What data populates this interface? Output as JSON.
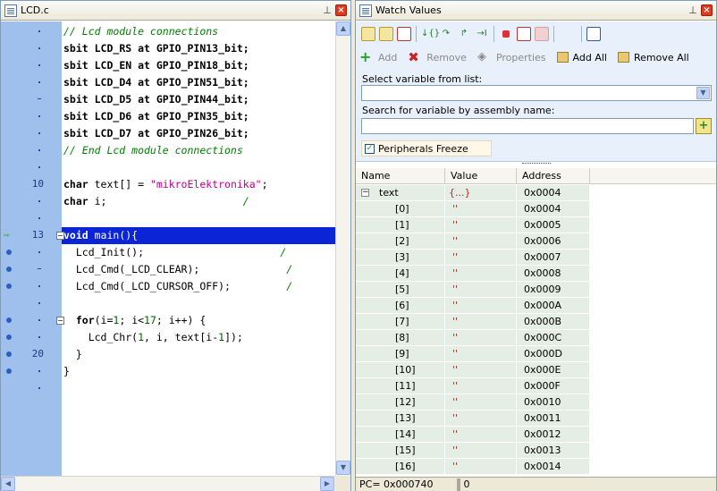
{
  "editor": {
    "title": "LCD.c",
    "gutter": [
      {
        "n": "",
        "m": "dot",
        "bp": false,
        "arrow": false
      },
      {
        "n": "",
        "m": "dot",
        "bp": false,
        "arrow": false
      },
      {
        "n": "",
        "m": "dot",
        "bp": false,
        "arrow": false
      },
      {
        "n": "",
        "m": "dot",
        "bp": false,
        "arrow": false
      },
      {
        "n": "",
        "m": "dash",
        "bp": false,
        "arrow": false
      },
      {
        "n": "",
        "m": "dot",
        "bp": false,
        "arrow": false
      },
      {
        "n": "",
        "m": "dot",
        "bp": false,
        "arrow": false
      },
      {
        "n": "",
        "m": "dot",
        "bp": false,
        "arrow": false
      },
      {
        "n": "",
        "m": "dot",
        "bp": false,
        "arrow": false
      },
      {
        "n": "10",
        "m": "",
        "bp": false,
        "arrow": false
      },
      {
        "n": "",
        "m": "dot",
        "bp": false,
        "arrow": false
      },
      {
        "n": "",
        "m": "dot",
        "bp": false,
        "arrow": false
      },
      {
        "n": "13",
        "m": "",
        "bp": false,
        "arrow": true
      },
      {
        "n": "",
        "m": "dot",
        "bp": true,
        "arrow": false
      },
      {
        "n": "",
        "m": "dash",
        "bp": true,
        "arrow": false
      },
      {
        "n": "",
        "m": "dot",
        "bp": true,
        "arrow": false
      },
      {
        "n": "",
        "m": "dot",
        "bp": false,
        "arrow": false
      },
      {
        "n": "",
        "m": "dot",
        "bp": true,
        "arrow": false
      },
      {
        "n": "",
        "m": "dot",
        "bp": true,
        "arrow": false
      },
      {
        "n": "20",
        "m": "",
        "bp": true,
        "arrow": false
      },
      {
        "n": "",
        "m": "dot",
        "bp": true,
        "arrow": false
      },
      {
        "n": "",
        "m": "dot",
        "bp": false,
        "arrow": false
      }
    ],
    "lines": [
      [
        {
          "t": "// Lcd module connections",
          "c": "cm"
        }
      ],
      [
        {
          "t": "sbit ",
          "c": "kw"
        },
        {
          "t": "LCD_RS ",
          "c": "kw"
        },
        {
          "t": "at ",
          "c": "kw"
        },
        {
          "t": "GPIO_PIN13_bit;",
          "c": "kw"
        }
      ],
      [
        {
          "t": "sbit ",
          "c": "kw"
        },
        {
          "t": "LCD_EN ",
          "c": "kw"
        },
        {
          "t": "at ",
          "c": "kw"
        },
        {
          "t": "GPIO_PIN18_bit;",
          "c": "kw"
        }
      ],
      [
        {
          "t": "sbit ",
          "c": "kw"
        },
        {
          "t": "LCD_D4 ",
          "c": "kw"
        },
        {
          "t": "at ",
          "c": "kw"
        },
        {
          "t": "GPIO_PIN51_bit;",
          "c": "kw"
        }
      ],
      [
        {
          "t": "sbit ",
          "c": "kw"
        },
        {
          "t": "LCD_D5 ",
          "c": "kw"
        },
        {
          "t": "at ",
          "c": "kw"
        },
        {
          "t": "GPIO_PIN44_bit;",
          "c": "kw"
        }
      ],
      [
        {
          "t": "sbit ",
          "c": "kw"
        },
        {
          "t": "LCD_D6 ",
          "c": "kw"
        },
        {
          "t": "at ",
          "c": "kw"
        },
        {
          "t": "GPIO_PIN35_bit;",
          "c": "kw"
        }
      ],
      [
        {
          "t": "sbit ",
          "c": "kw"
        },
        {
          "t": "LCD_D7 ",
          "c": "kw"
        },
        {
          "t": "at ",
          "c": "kw"
        },
        {
          "t": "GPIO_PIN26_bit;",
          "c": "kw"
        }
      ],
      [
        {
          "t": "// End Lcd module connections",
          "c": "cm"
        }
      ],
      [],
      [
        {
          "t": "char ",
          "c": "kw"
        },
        {
          "t": "text[] = ",
          "c": ""
        },
        {
          "t": "\"mikroElektronika\"",
          "c": "st"
        },
        {
          "t": ";",
          "c": ""
        }
      ],
      [
        {
          "t": "char ",
          "c": "kw"
        },
        {
          "t": "i;",
          "c": ""
        },
        {
          "t": "                      /",
          "c": "cm"
        }
      ],
      [],
      [
        {
          "t": "void ",
          "c": "kw"
        },
        {
          "t": "main(){",
          "c": ""
        }
      ],
      [
        {
          "t": "  Lcd_Init();",
          "c": ""
        },
        {
          "t": "                      /",
          "c": "cm"
        }
      ],
      [
        {
          "t": "  Lcd_Cmd(_LCD_CLEAR);",
          "c": ""
        },
        {
          "t": "              /",
          "c": "cm"
        }
      ],
      [
        {
          "t": "  Lcd_Cmd(_LCD_CURSOR_OFF);",
          "c": ""
        },
        {
          "t": "         /",
          "c": "cm"
        }
      ],
      [],
      [
        {
          "t": "  for",
          "c": "kw"
        },
        {
          "t": "(i=",
          "c": ""
        },
        {
          "t": "1",
          "c": "nm"
        },
        {
          "t": "; i<",
          "c": ""
        },
        {
          "t": "17",
          "c": "nm"
        },
        {
          "t": "; i++) {",
          "c": ""
        }
      ],
      [
        {
          "t": "    Lcd_Chr(",
          "c": ""
        },
        {
          "t": "1",
          "c": "nm"
        },
        {
          "t": ", i, text[i-",
          "c": ""
        },
        {
          "t": "1",
          "c": "nm"
        },
        {
          "t": "]);",
          "c": ""
        }
      ],
      [
        {
          "t": "  }",
          "c": ""
        }
      ],
      [
        {
          "t": "}",
          "c": ""
        }
      ],
      []
    ],
    "highlight_line": 12
  },
  "watch": {
    "title": "Watch Values",
    "toolbar_actions": {
      "add": "Add",
      "remove": "Remove",
      "properties": "Properties",
      "add_all": "Add All",
      "remove_all": "Remove All"
    },
    "select_label": "Select variable from list:",
    "select_value": "",
    "search_label": "Search for variable by assembly name:",
    "search_value": "",
    "peripherals_freeze": "Peripherals Freeze",
    "columns": [
      "Name",
      "Value",
      "Address"
    ],
    "rows": [
      {
        "name": "text",
        "value": "{...}",
        "address": "0x0004",
        "indent": false,
        "toggle": "−"
      },
      {
        "name": "[0]",
        "value": "''",
        "address": "0x0004",
        "indent": true,
        "toggle": ""
      },
      {
        "name": "[1]",
        "value": "''",
        "address": "0x0005",
        "indent": true,
        "toggle": ""
      },
      {
        "name": "[2]",
        "value": "''",
        "address": "0x0006",
        "indent": true,
        "toggle": ""
      },
      {
        "name": "[3]",
        "value": "''",
        "address": "0x0007",
        "indent": true,
        "toggle": ""
      },
      {
        "name": "[4]",
        "value": "''",
        "address": "0x0008",
        "indent": true,
        "toggle": ""
      },
      {
        "name": "[5]",
        "value": "''",
        "address": "0x0009",
        "indent": true,
        "toggle": ""
      },
      {
        "name": "[6]",
        "value": "''",
        "address": "0x000A",
        "indent": true,
        "toggle": ""
      },
      {
        "name": "[7]",
        "value": "''",
        "address": "0x000B",
        "indent": true,
        "toggle": ""
      },
      {
        "name": "[8]",
        "value": "''",
        "address": "0x000C",
        "indent": true,
        "toggle": ""
      },
      {
        "name": "[9]",
        "value": "''",
        "address": "0x000D",
        "indent": true,
        "toggle": ""
      },
      {
        "name": "[10]",
        "value": "''",
        "address": "0x000E",
        "indent": true,
        "toggle": ""
      },
      {
        "name": "[11]",
        "value": "''",
        "address": "0x000F",
        "indent": true,
        "toggle": ""
      },
      {
        "name": "[12]",
        "value": "''",
        "address": "0x0010",
        "indent": true,
        "toggle": ""
      },
      {
        "name": "[13]",
        "value": "''",
        "address": "0x0011",
        "indent": true,
        "toggle": ""
      },
      {
        "name": "[14]",
        "value": "''",
        "address": "0x0012",
        "indent": true,
        "toggle": ""
      },
      {
        "name": "[15]",
        "value": "''",
        "address": "0x0013",
        "indent": true,
        "toggle": ""
      },
      {
        "name": "[16]",
        "value": "''",
        "address": "0x0014",
        "indent": true,
        "toggle": ""
      }
    ],
    "status_pc": "PC= 0x000740",
    "status_val": "0"
  }
}
